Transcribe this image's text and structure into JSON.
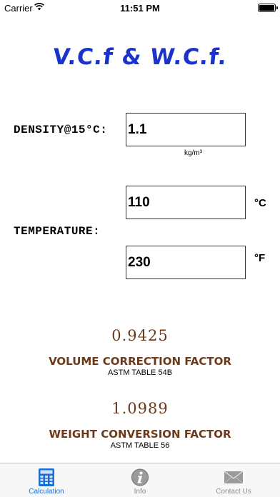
{
  "status_bar": {
    "carrier": "Carrier",
    "time": "11:51 PM"
  },
  "title": "V.C.f & W.C.f.",
  "density": {
    "label": "DENSITY@15°C:",
    "value": "1.1",
    "unit": "kg/m³"
  },
  "temperature": {
    "label": "TEMPERATURE:",
    "celsius": {
      "value": "110",
      "unit": "°C"
    },
    "fahrenheit": {
      "value": "230",
      "unit": "°F"
    }
  },
  "results": {
    "vcf": {
      "value": "0.9425",
      "label": "VOLUME CORRECTION FACTOR",
      "table": "ASTM TABLE 54B"
    },
    "wcf": {
      "value": "1.0989",
      "label": "WEIGHT CONVERSION FACTOR",
      "table": "ASTM TABLE 56"
    }
  },
  "tabs": [
    {
      "label": "Calculation",
      "icon": "calculator-icon",
      "active": true
    },
    {
      "label": "Info",
      "icon": "info-icon",
      "active": false
    },
    {
      "label": "Contact Us",
      "icon": "envelope-icon",
      "active": false
    }
  ],
  "colors": {
    "title": "#1a33cc",
    "result": "#6b3a1c",
    "tab_active": "#1a6fd6",
    "tab_inactive": "#8e8e8e"
  }
}
